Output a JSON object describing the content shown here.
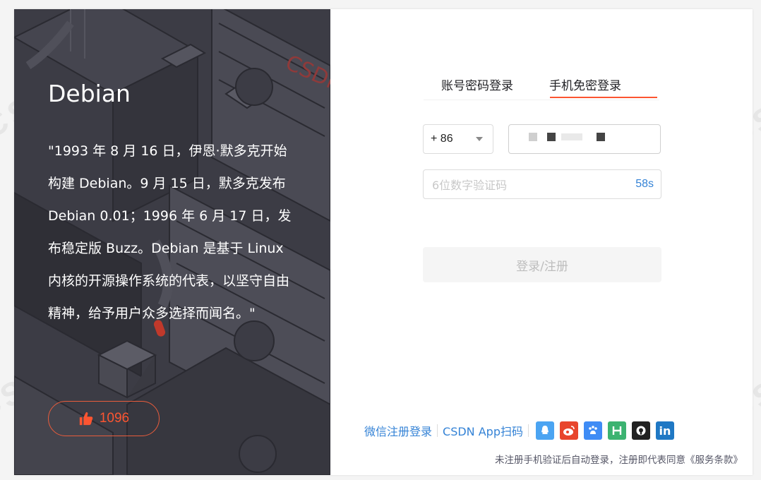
{
  "quote": {
    "title": "Debian",
    "text": "\"1993 年 8 月 16 日，伊恩·默多克开始构建 Debian。9 月 15 日，默多克发布 Debian 0.01；1996 年 6 月 17 日，发布稳定版 Buzz。Debian 是基于 Linux 内核的开源操作系统的代表，以坚守自由精神，给予用户众多选择而闻名。\"",
    "likes": "1096",
    "illustration_mark": "CSDN"
  },
  "login": {
    "tabs": [
      "账号密码登录",
      "手机免密登录"
    ],
    "active_tab_index": 1,
    "country_code": "+ 86",
    "phone_value": "",
    "code_placeholder": "6位数字验证码",
    "countdown": "58s",
    "submit_label": "登录/注册"
  },
  "other_login": {
    "wechat": "微信注册登录",
    "app_scan": "CSDN App扫码",
    "icons": [
      {
        "name": "qq-icon",
        "color": "#4ba4f2",
        "glyph": "🔔"
      },
      {
        "name": "weibo-icon",
        "color": "#e8452c",
        "glyph": "ⓦ"
      },
      {
        "name": "baidu-icon",
        "color": "#3f8cf5",
        "glyph": "🐾"
      },
      {
        "name": "html5-icon",
        "color": "#3cb371",
        "glyph": "H"
      },
      {
        "name": "github-icon",
        "color": "#222222",
        "glyph": "⊙"
      },
      {
        "name": "linkedin-icon",
        "color": "#1f78c4",
        "glyph": "in"
      }
    ]
  },
  "agreement": {
    "text": "未注册手机验证后自动登录，注册即代表同意",
    "terms": "《服务条款》"
  },
  "colors": {
    "accent": "#fc5531",
    "link": "#3583d6",
    "left_panel": "#3c3c45"
  }
}
